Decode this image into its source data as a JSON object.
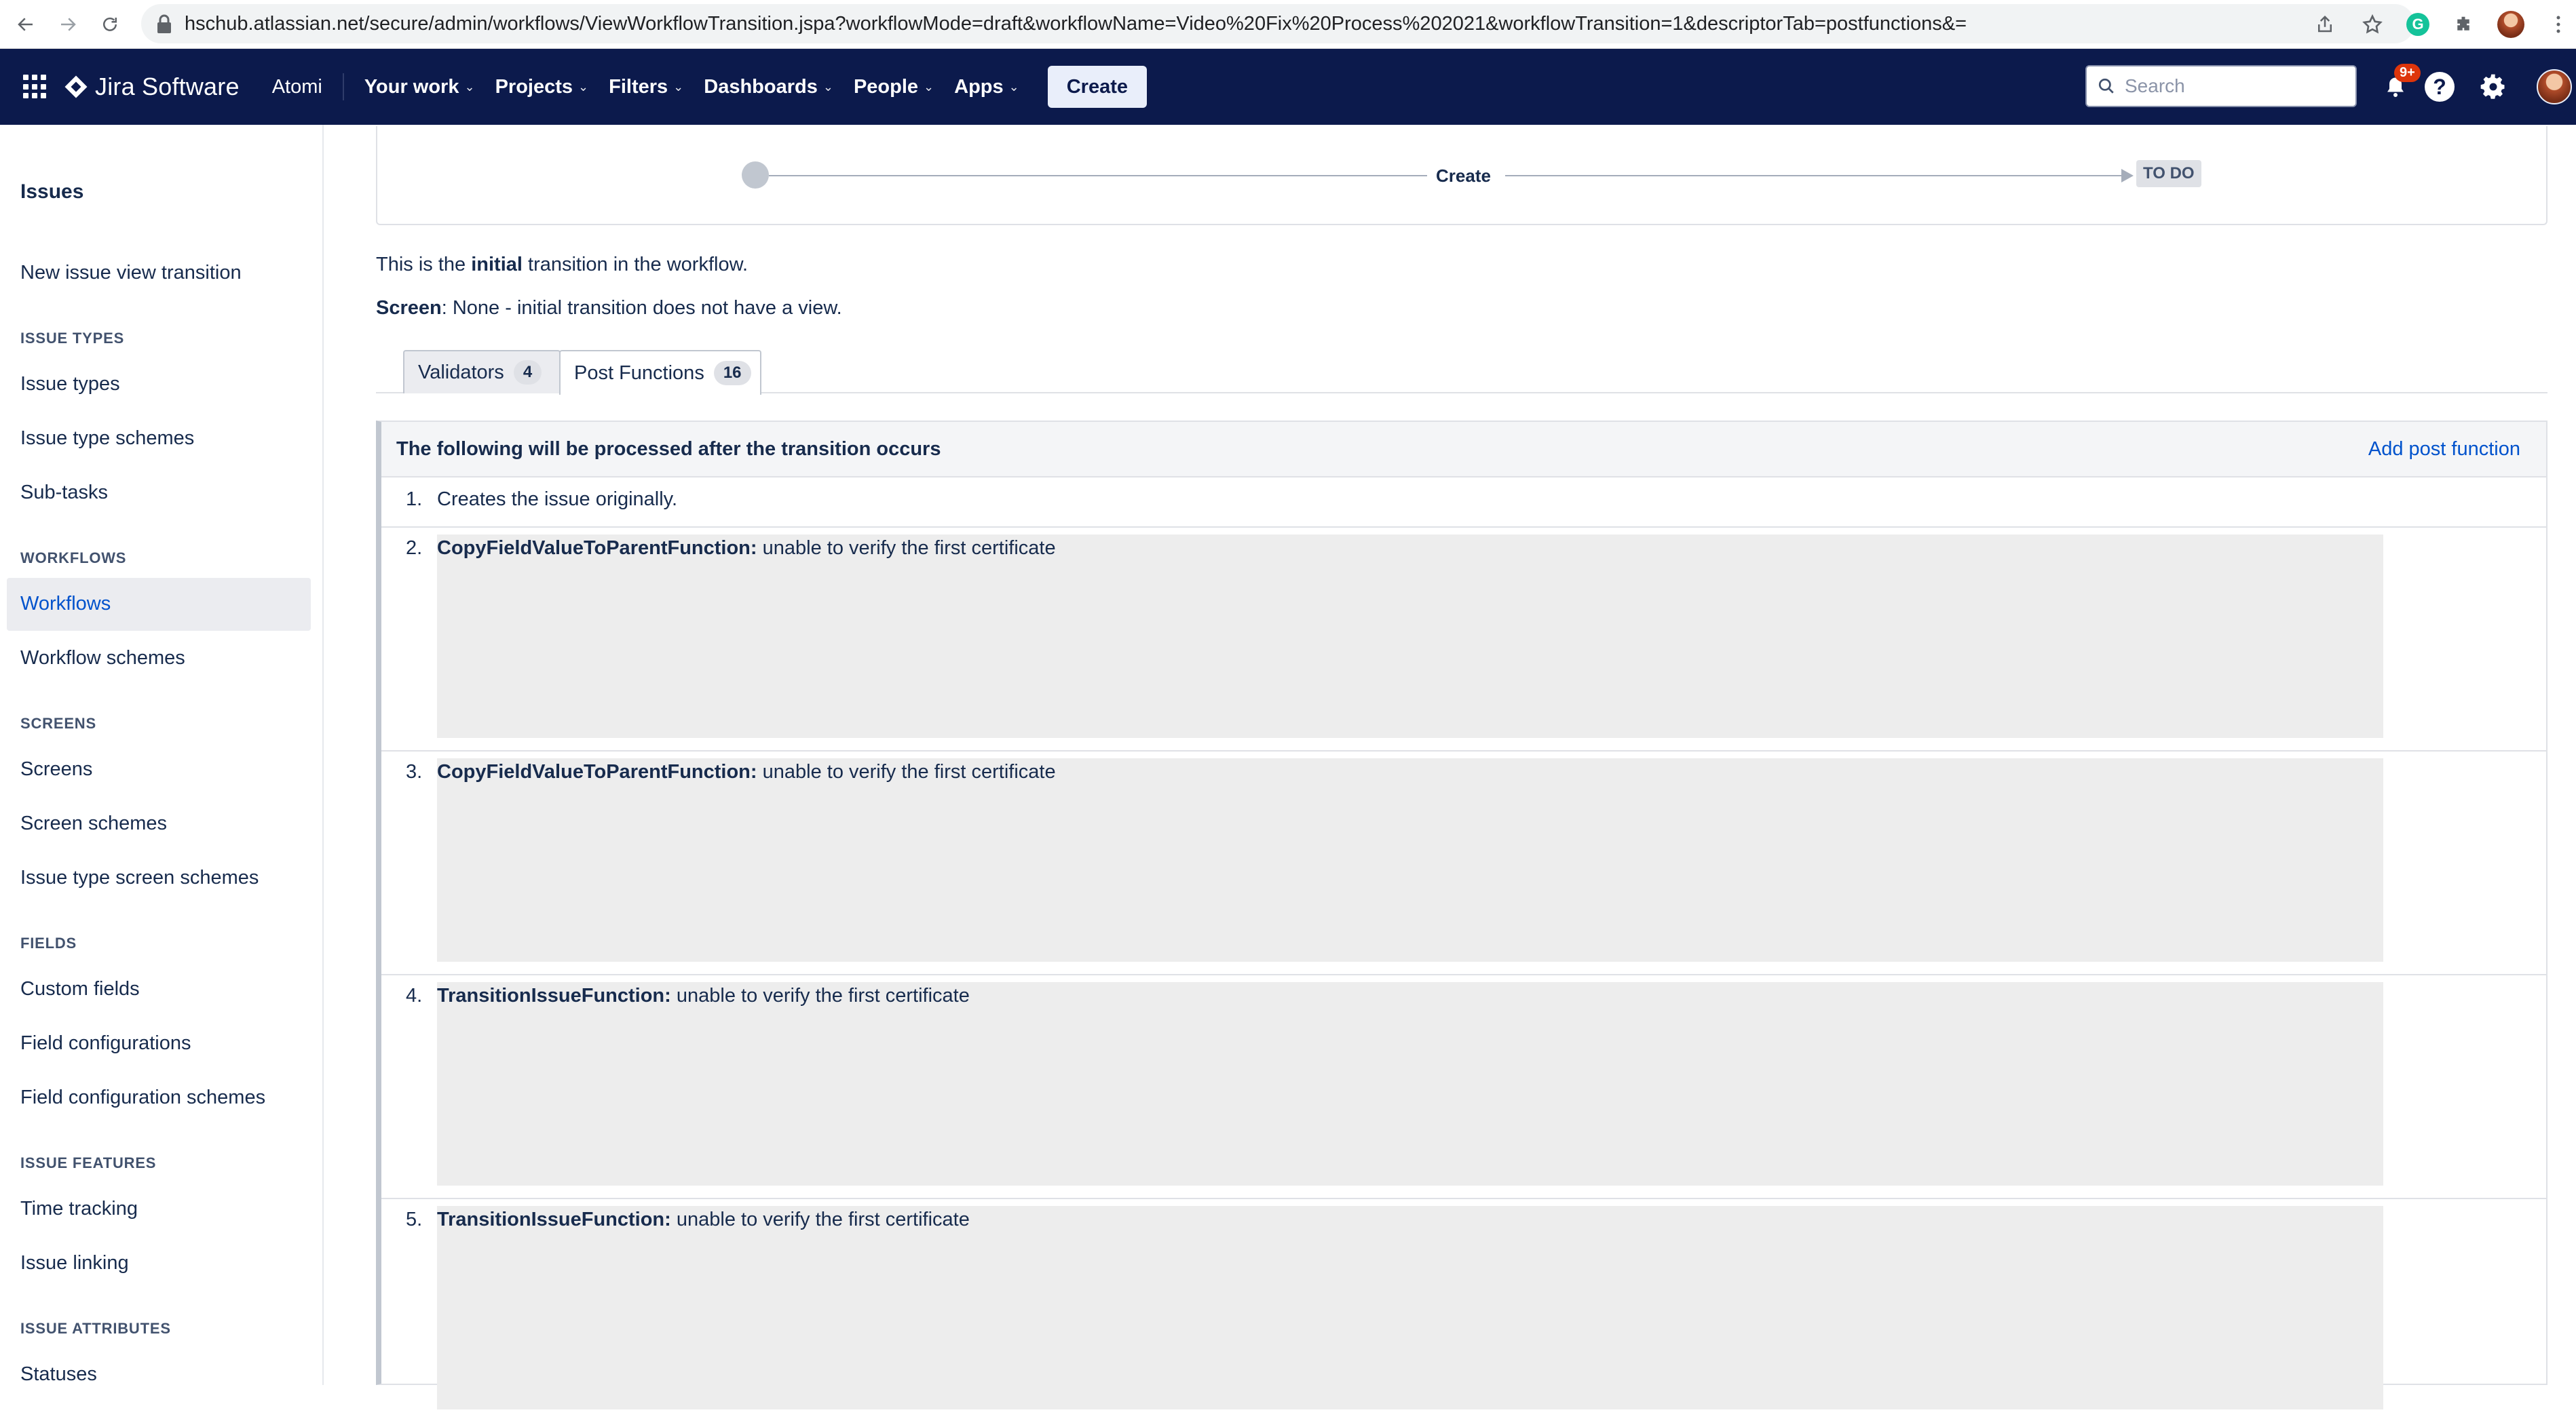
{
  "browser": {
    "url_host": "hschub.atlassian.net",
    "url_path": "/secure/admin/workflows/ViewWorkflowTransition.jspa?workflowMode=draft&workflowName=Video%20Fix%20Process%202021&workflowTransition=1&descriptorTab=postfunctions&="
  },
  "topnav": {
    "product": "Jira Software",
    "site": "Atomi",
    "items": [
      "Your work",
      "Projects",
      "Filters",
      "Dashboards",
      "People",
      "Apps"
    ],
    "create_label": "Create",
    "search_placeholder": "Search",
    "notification_badge": "9+",
    "help_label": "?"
  },
  "sidebar": {
    "title": "Issues",
    "top_link": "New issue view transition",
    "sections": [
      {
        "heading": "ISSUE TYPES",
        "items": [
          "Issue types",
          "Issue type schemes",
          "Sub-tasks"
        ]
      },
      {
        "heading": "WORKFLOWS",
        "items": [
          "Workflows",
          "Workflow schemes"
        ]
      },
      {
        "heading": "SCREENS",
        "items": [
          "Screens",
          "Screen schemes",
          "Issue type screen schemes"
        ]
      },
      {
        "heading": "FIELDS",
        "items": [
          "Custom fields",
          "Field configurations",
          "Field configuration schemes"
        ]
      },
      {
        "heading": "ISSUE FEATURES",
        "items": [
          "Time tracking",
          "Issue linking"
        ]
      },
      {
        "heading": "ISSUE ATTRIBUTES",
        "items": [
          "Statuses"
        ]
      }
    ],
    "active_item": "Workflows"
  },
  "diagram": {
    "transition_label": "Create",
    "target_status": "TO DO"
  },
  "info": {
    "initial_prefix": "This is the ",
    "initial_bold": "initial",
    "initial_suffix": " transition in the workflow.",
    "screen_label": "Screen",
    "screen_value": ": None - initial transition does not have a view."
  },
  "tabs": [
    {
      "label": "Validators",
      "count": "4"
    },
    {
      "label": "Post Functions",
      "count": "16"
    }
  ],
  "post_functions": {
    "header": "The following will be processed after the transition occurs",
    "add_label": "Add post function",
    "rows": [
      {
        "num": "1.",
        "name": "",
        "text": "Creates the issue originally."
      },
      {
        "num": "2.",
        "name": "CopyFieldValueToParentFunction:",
        "text": " unable to verify the first certificate"
      },
      {
        "num": "3.",
        "name": "CopyFieldValueToParentFunction:",
        "text": " unable to verify the first certificate"
      },
      {
        "num": "4.",
        "name": "TransitionIssueFunction:",
        "text": " unable to verify the first certificate"
      },
      {
        "num": "5.",
        "name": "TransitionIssueFunction:",
        "text": " unable to verify the first certificate"
      }
    ]
  }
}
